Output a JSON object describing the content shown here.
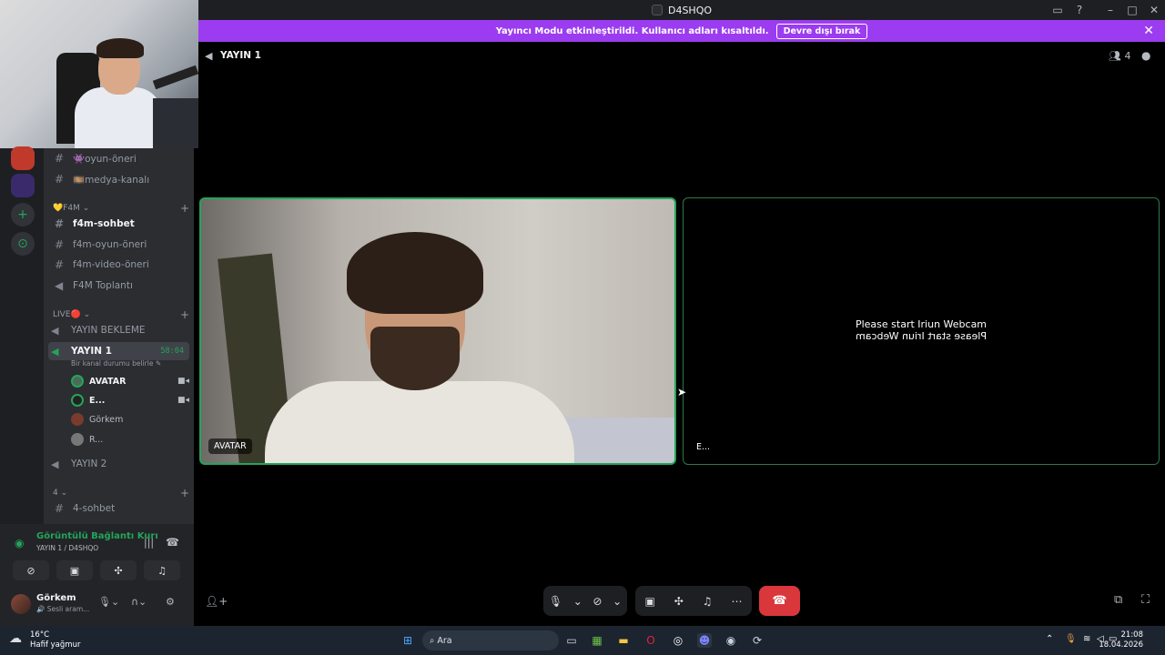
{
  "window": {
    "title": "D4SHQO"
  },
  "banner": {
    "message": "Yayıncı Modu etkinleştirildi. Kullanıcı adları kısaltıldı.",
    "button_label": "Devre dışı bırak"
  },
  "channels": {
    "top_items": [
      {
        "label": "👾oyun-öneri"
      },
      {
        "label": "🎞️medya-kanalı"
      }
    ],
    "category_f4m": "💛F4M",
    "f4m_items": [
      {
        "label": "f4m-sohbet"
      },
      {
        "label": "f4m-oyun-öneri"
      },
      {
        "label": "f4m-video-öneri"
      },
      {
        "label": "F4M Toplantı"
      }
    ],
    "category_live": "LIVE🔴",
    "voice_wait": "YAYIN BEKLEME",
    "voice_selected": "YAYIN 1",
    "voice_timer": "58:04",
    "voice_status": "Bir kanal durumu belirle ✎",
    "voice_users": [
      {
        "name": "AVATAR"
      },
      {
        "name": "E..."
      },
      {
        "name": "Görkem"
      },
      {
        "name": "R..."
      }
    ],
    "voice_2": "YAYIN 2",
    "category_4": "4",
    "ch_4": "4-sohbet"
  },
  "voice_panel": {
    "status": "Görüntülü Bağlantı Kurı",
    "sub": "YAYIN 1 / D4SHQO"
  },
  "user_panel": {
    "name": "Görkem",
    "status": "🔊 Sesli aram..."
  },
  "stage": {
    "title": "YAYIN 1",
    "participants": "4",
    "tiles": [
      {
        "name": "AVATAR"
      },
      {
        "name": "E..."
      }
    ],
    "webcam_message": "Please start Iriun Webcam",
    "webcam_message_mirrored": "Please start Iriun Webcam"
  },
  "taskbar": {
    "weather_temp": "16°C",
    "weather_desc": "Hafif yağmur",
    "search_placeholder": "Ara",
    "time": "21:08",
    "date": "18.04.2026"
  },
  "colors": {
    "banner": "#9b3cf0",
    "speaking_border": "#23a55a",
    "hangup": "#da373c"
  }
}
